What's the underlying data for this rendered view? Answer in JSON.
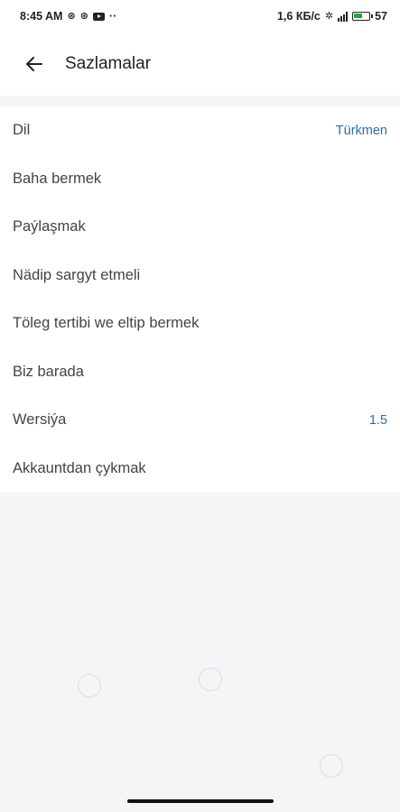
{
  "status_bar": {
    "time": "8:45 AM",
    "dots": "··",
    "speed": "1,6 КБ/с",
    "battery": "57"
  },
  "header": {
    "title": "Sazlamalar"
  },
  "settings": {
    "items": [
      {
        "label": "Dil",
        "value": "Türkmen"
      },
      {
        "label": "Baha bermek",
        "value": ""
      },
      {
        "label": "Paýlaşmak",
        "value": ""
      },
      {
        "label": "Nädip sargyt etmeli",
        "value": ""
      },
      {
        "label": "Töleg tertibi we eltip bermek",
        "value": ""
      },
      {
        "label": "Biz barada",
        "value": ""
      },
      {
        "label": "Wersiýa",
        "value": "1.5"
      },
      {
        "label": "Akkauntdan çykmak",
        "value": ""
      }
    ]
  },
  "colors": {
    "accent": "#2c6ea6",
    "background": "#f4f5f7"
  }
}
